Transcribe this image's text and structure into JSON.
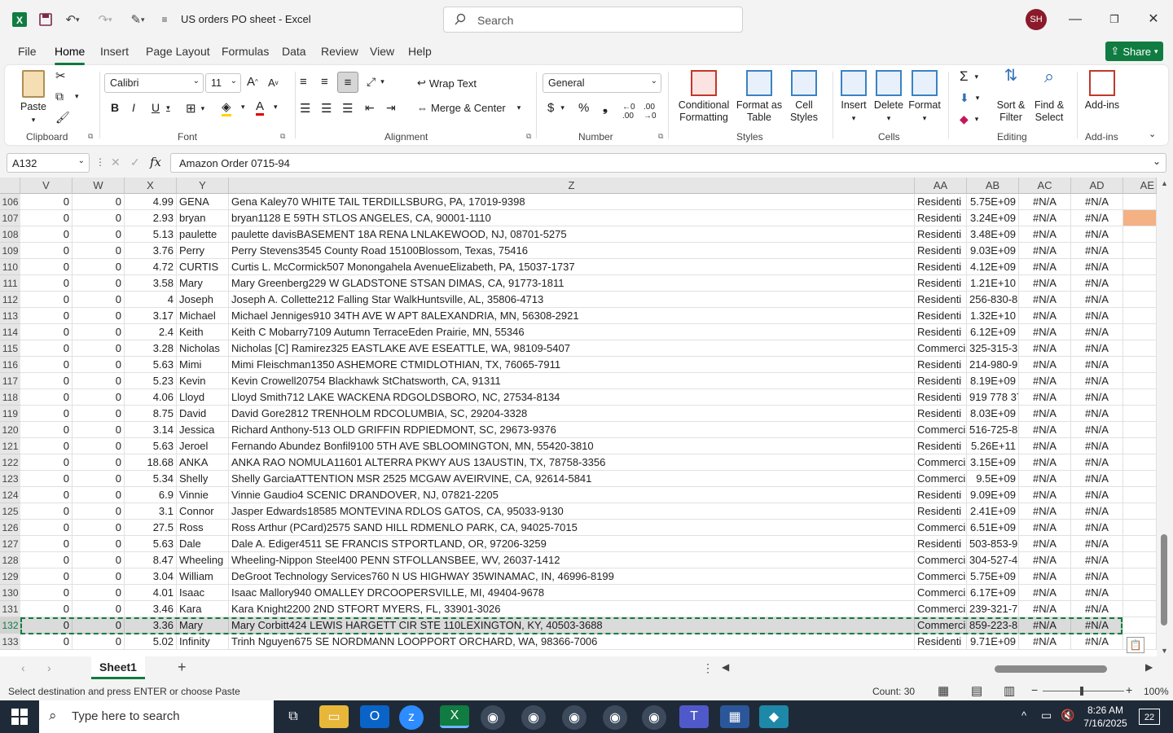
{
  "app": {
    "title": "US orders PO sheet  -  Excel",
    "search_placeholder": "Search",
    "avatar": "SH",
    "share": "Share"
  },
  "menu": [
    "File",
    "Home",
    "Insert",
    "Page Layout",
    "Formulas",
    "Data",
    "Review",
    "View",
    "Help"
  ],
  "ribbon": {
    "clipboard": {
      "label": "Clipboard",
      "paste": "Paste"
    },
    "font": {
      "label": "Font",
      "name": "Calibri",
      "size": "11"
    },
    "alignment": {
      "label": "Alignment",
      "wrap": "Wrap Text",
      "merge": "Merge & Center"
    },
    "number": {
      "label": "Number",
      "format": "General"
    },
    "styles": {
      "label": "Styles",
      "conditional": "Conditional Formatting",
      "format_table": "Format as Table",
      "cell_styles": "Cell Styles"
    },
    "cells": {
      "label": "Cells",
      "insert": "Insert",
      "delete": "Delete",
      "format": "Format"
    },
    "editing": {
      "label": "Editing",
      "sort": "Sort & Filter",
      "find": "Find & Select"
    },
    "addins": {
      "label": "Add-ins",
      "addins": "Add-ins"
    }
  },
  "formula": {
    "namebox": "A132",
    "content": "Amazon Order 0715-94"
  },
  "columns": [
    "V",
    "W",
    "X",
    "Y",
    "Z",
    "AA",
    "AB",
    "AC",
    "AD",
    "AE"
  ],
  "rows": [
    {
      "r": "106",
      "v": "0",
      "w": "0",
      "x": "4.99",
      "y": "GENA",
      "z": "Gena Kaley70 WHITE TAIL TERDILLSBURG, PA, 17019-9398",
      "aa": "Residenti",
      "ab": "5.75E+09",
      "ac": "#N/A",
      "ad": "#N/A"
    },
    {
      "r": "107",
      "v": "0",
      "w": "0",
      "x": "2.93",
      "y": "bryan",
      "z": "bryan1128 E 59TH STLOS ANGELES, CA, 90001-1110",
      "aa": "Residenti",
      "ab": "3.24E+09",
      "ac": "#N/A",
      "ad": "#N/A"
    },
    {
      "r": "108",
      "v": "0",
      "w": "0",
      "x": "5.13",
      "y": "paulette",
      "z": "paulette davisBASEMENT 18A RENA LNLAKEWOOD, NJ, 08701-5275",
      "aa": "Residenti",
      "ab": "3.48E+09",
      "ac": "#N/A",
      "ad": "#N/A"
    },
    {
      "r": "109",
      "v": "0",
      "w": "0",
      "x": "3.76",
      "y": "Perry",
      "z": "Perry Stevens3545 County Road 15100Blossom, Texas, 75416",
      "aa": "Residenti",
      "ab": "9.03E+09",
      "ac": "#N/A",
      "ad": "#N/A"
    },
    {
      "r": "110",
      "v": "0",
      "w": "0",
      "x": "4.72",
      "y": "CURTIS",
      "z": "Curtis L. McCormick507 Monongahela AvenueElizabeth, PA, 15037-1737",
      "aa": "Residenti",
      "ab": "4.12E+09",
      "ac": "#N/A",
      "ad": "#N/A"
    },
    {
      "r": "111",
      "v": "0",
      "w": "0",
      "x": "3.58",
      "y": "Mary",
      "z": "Mary Greenberg229 W GLADSTONE STSAN DIMAS, CA, 91773-1811",
      "aa": "Residenti",
      "ab": "1.21E+10",
      "ac": "#N/A",
      "ad": "#N/A"
    },
    {
      "r": "112",
      "v": "0",
      "w": "0",
      "x": "4",
      "y": "Joseph",
      "z": "Joseph A. Collette212 Falling Star WalkHuntsville, AL, 35806-4713",
      "aa": "Residenti",
      "ab": "256-830-8",
      "ac": "#N/A",
      "ad": "#N/A"
    },
    {
      "r": "113",
      "v": "0",
      "w": "0",
      "x": "3.17",
      "y": "Michael",
      "z": "Michael Jenniges910 34TH AVE W APT 8ALEXANDRIA, MN, 56308-2921",
      "aa": "Residenti",
      "ab": "1.32E+10",
      "ac": "#N/A",
      "ad": "#N/A"
    },
    {
      "r": "114",
      "v": "0",
      "w": "0",
      "x": "2.4",
      "y": "Keith",
      "z": "Keith C Mobarry7109 Autumn TerraceEden Prairie, MN, 55346",
      "aa": "Residenti",
      "ab": "6.12E+09",
      "ac": "#N/A",
      "ad": "#N/A"
    },
    {
      "r": "115",
      "v": "0",
      "w": "0",
      "x": "3.28",
      "y": "Nicholas",
      "z": "Nicholas [C] Ramirez325 EASTLAKE AVE ESEATTLE, WA, 98109-5407",
      "aa": "Commerci",
      "ab": "325-315-3",
      "ac": "#N/A",
      "ad": "#N/A"
    },
    {
      "r": "116",
      "v": "0",
      "w": "0",
      "x": "5.63",
      "y": "Mimi",
      "z": "Mimi Fleischman1350 ASHEMORE CTMIDLOTHIAN, TX, 76065-7911",
      "aa": "Residenti",
      "ab": "214-980-9",
      "ac": "#N/A",
      "ad": "#N/A"
    },
    {
      "r": "117",
      "v": "0",
      "w": "0",
      "x": "5.23",
      "y": "Kevin",
      "z": "Kevin Crowell20754 Blackhawk StChatsworth, CA, 91311",
      "aa": "Residenti",
      "ab": "8.19E+09",
      "ac": "#N/A",
      "ad": "#N/A"
    },
    {
      "r": "118",
      "v": "0",
      "w": "0",
      "x": "4.06",
      "y": "Lloyd",
      "z": "Lloyd Smith712 LAKE WACKENA RDGOLDSBORO, NC, 27534-8134",
      "aa": "Residenti",
      "ab": "919 778 37",
      "ac": "#N/A",
      "ad": "#N/A"
    },
    {
      "r": "119",
      "v": "0",
      "w": "0",
      "x": "8.75",
      "y": "David",
      "z": "David Gore2812 TRENHOLM RDCOLUMBIA, SC, 29204-3328",
      "aa": "Residenti",
      "ab": "8.03E+09",
      "ac": "#N/A",
      "ad": "#N/A"
    },
    {
      "r": "120",
      "v": "0",
      "w": "0",
      "x": "3.14",
      "y": "Jessica",
      "z": "Richard Anthony-513 OLD GRIFFIN RDPIEDMONT, SC, 29673-9376",
      "aa": "Commerci",
      "ab": "516-725-8",
      "ac": "#N/A",
      "ad": "#N/A"
    },
    {
      "r": "121",
      "v": "0",
      "w": "0",
      "x": "5.63",
      "y": "Jeroel",
      "z": "Fernando Abundez Bonfil9100 5TH AVE SBLOOMINGTON, MN, 55420-3810",
      "aa": "Residenti",
      "ab": "5.26E+11",
      "ac": "#N/A",
      "ad": "#N/A"
    },
    {
      "r": "122",
      "v": "0",
      "w": "0",
      "x": "18.68",
      "y": "ANKA",
      "z": "ANKA RAO NOMULA11601 ALTERRA PKWY AUS 13AUSTIN, TX, 78758-3356",
      "aa": "Commerci",
      "ab": "3.15E+09",
      "ac": "#N/A",
      "ad": "#N/A"
    },
    {
      "r": "123",
      "v": "0",
      "w": "0",
      "x": "5.34",
      "y": "Shelly",
      "z": "Shelly GarciaATTENTION MSR 2525 MCGAW AVEIRVINE, CA, 92614-5841",
      "aa": "Commerci",
      "ab": "9.5E+09",
      "ac": "#N/A",
      "ad": "#N/A"
    },
    {
      "r": "124",
      "v": "0",
      "w": "0",
      "x": "6.9",
      "y": "Vinnie",
      "z": "Vinnie Gaudio4 SCENIC DRANDOVER, NJ, 07821-2205",
      "aa": "Residenti",
      "ab": "9.09E+09",
      "ac": "#N/A",
      "ad": "#N/A"
    },
    {
      "r": "125",
      "v": "0",
      "w": "0",
      "x": "3.1",
      "y": "Connor",
      "z": "Jasper Edwards18585 MONTEVINA RDLOS GATOS, CA, 95033-9130",
      "aa": "Residenti",
      "ab": "2.41E+09",
      "ac": "#N/A",
      "ad": "#N/A"
    },
    {
      "r": "126",
      "v": "0",
      "w": "0",
      "x": "27.5",
      "y": "Ross",
      "z": "Ross Arthur (PCard)2575 SAND HILL RDMENLO PARK, CA, 94025-7015",
      "aa": "Commerci",
      "ab": "6.51E+09",
      "ac": "#N/A",
      "ad": "#N/A"
    },
    {
      "r": "127",
      "v": "0",
      "w": "0",
      "x": "5.63",
      "y": "Dale",
      "z": "Dale A. Ediger4511 SE FRANCIS STPORTLAND, OR, 97206-3259",
      "aa": "Residenti",
      "ab": "503-853-9",
      "ac": "#N/A",
      "ad": "#N/A"
    },
    {
      "r": "128",
      "v": "0",
      "w": "0",
      "x": "8.47",
      "y": "Wheeling",
      "z": "Wheeling-Nippon Steel400 PENN STFOLLANSBEE, WV, 26037-1412",
      "aa": "Commerci",
      "ab": "304-527-4",
      "ac": "#N/A",
      "ad": "#N/A"
    },
    {
      "r": "129",
      "v": "0",
      "w": "0",
      "x": "3.04",
      "y": "William",
      "z": "DeGroot Technology Services760 N US HIGHWAY 35WINAMAC, IN, 46996-8199",
      "aa": "Commerci",
      "ab": "5.75E+09",
      "ac": "#N/A",
      "ad": "#N/A"
    },
    {
      "r": "130",
      "v": "0",
      "w": "0",
      "x": "4.01",
      "y": "Isaac",
      "z": "Isaac Mallory940 OMALLEY DRCOOPERSVILLE, MI, 49404-9678",
      "aa": "Commerci",
      "ab": "6.17E+09",
      "ac": "#N/A",
      "ad": "#N/A"
    },
    {
      "r": "131",
      "v": "0",
      "w": "0",
      "x": "3.46",
      "y": "Kara",
      "z": "Kara Knight2200 2ND STFORT MYERS, FL, 33901-3026",
      "aa": "Commerci",
      "ab": "239-321-7",
      "ac": "#N/A",
      "ad": "#N/A"
    },
    {
      "r": "132",
      "v": "0",
      "w": "0",
      "x": "3.36",
      "y": "Mary",
      "z": "Mary Corbitt424 LEWIS HARGETT CIR STE 110LEXINGTON, KY, 40503-3688",
      "aa": "Commerci",
      "ab": "859-223-8",
      "ac": "#N/A",
      "ad": "#N/A"
    },
    {
      "r": "133",
      "v": "0",
      "w": "0",
      "x": "5.02",
      "y": "Infinity",
      "z": "Trinh Nguyen675 SE NORDMANN LOOPPORT ORCHARD, WA, 98366-7006",
      "aa": "Residenti",
      "ab": "9.71E+09",
      "ac": "#N/A",
      "ad": "#N/A"
    }
  ],
  "sheet_tab": "Sheet1",
  "status": {
    "left": "Select destination and press ENTER or choose Paste",
    "count": "Count: 30",
    "zoom": "100%"
  },
  "taskbar": {
    "search": "Type here to search",
    "time": "8:26 AM",
    "date": "7/16/2025",
    "notifications": "22"
  },
  "colors": {
    "excel_green": "#107c41",
    "highlight_cell": "#f4b183"
  }
}
